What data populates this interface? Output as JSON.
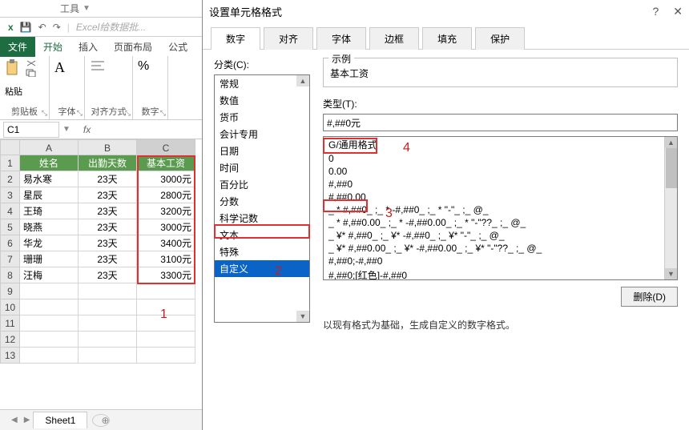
{
  "excel": {
    "top_tools": "工具",
    "qat_hint": "Excel给数据批...",
    "file_tab": "文件",
    "tabs": [
      "开始",
      "插入",
      "页面布局",
      "公式"
    ],
    "groups": {
      "clipboard": "剪贴板",
      "paste": "粘贴",
      "font": "字体",
      "align": "对齐方式",
      "number": "数字"
    },
    "namebox": "C1",
    "columns": [
      "A",
      "B",
      "C"
    ],
    "header_row": [
      "姓名",
      "出勤天数",
      "基本工资"
    ],
    "rows": [
      [
        "易水寒",
        "23天",
        "3000元"
      ],
      [
        "星辰",
        "23天",
        "2800元"
      ],
      [
        "王琦",
        "23天",
        "3200元"
      ],
      [
        "晓燕",
        "23天",
        "3000元"
      ],
      [
        "华龙",
        "23天",
        "3400元"
      ],
      [
        "珊珊",
        "23天",
        "3100元"
      ],
      [
        "汪梅",
        "23天",
        "3300元"
      ]
    ],
    "sheet": "Sheet1"
  },
  "dialog": {
    "title": "设置单元格格式",
    "tabs": [
      "数字",
      "对齐",
      "字体",
      "边框",
      "填充",
      "保护"
    ],
    "category_label": "分类(C):",
    "categories": [
      "常规",
      "数值",
      "货币",
      "会计专用",
      "日期",
      "时间",
      "百分比",
      "分数",
      "科学记数",
      "文本",
      "特殊",
      "自定义"
    ],
    "selected_category": "自定义",
    "example_label": "示例",
    "example_value": "基本工资",
    "type_label": "类型(T):",
    "type_value": "#,##0元",
    "formats": [
      "G/通用格式",
      "0",
      "0.00",
      "#,##0",
      "#,##0.00",
      "_ * #,##0_ ;_ * -#,##0_ ;_ * \"-\"_ ;_ @_ ",
      "_ * #,##0.00_ ;_ * -#,##0.00_ ;_ * \"-\"??_ ;_ @_ ",
      "_ ¥* #,##0_ ;_ ¥* -#,##0_ ;_ ¥* \"-\"_ ;_ @_ ",
      "_ ¥* #,##0.00_ ;_ ¥* -#,##0.00_ ;_ ¥* \"-\"??_ ;_ @_ ",
      "#,##0;-#,##0",
      "#,##0;[红色]-#,##0"
    ],
    "delete_btn": "删除(D)",
    "hint": "以现有格式为基础，生成自定义的数字格式。"
  },
  "annotations": {
    "n1": "1",
    "n2": "2",
    "n3": "3",
    "n4": "4"
  }
}
